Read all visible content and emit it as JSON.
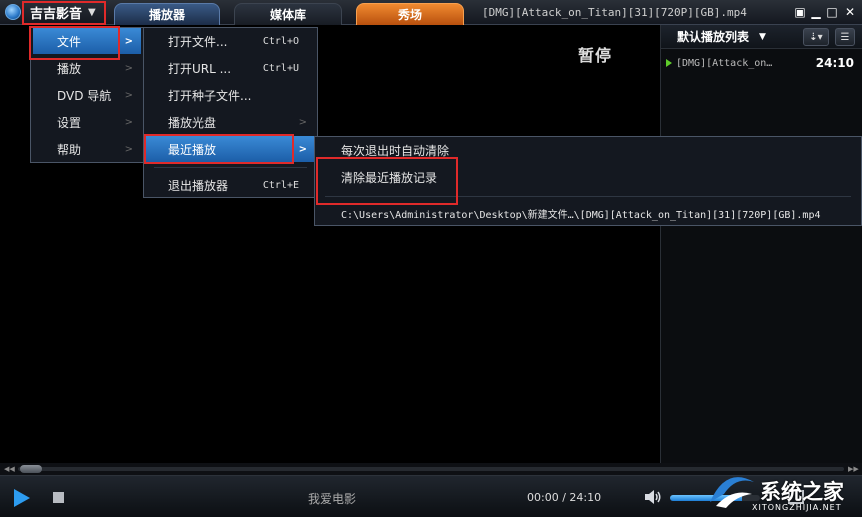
{
  "app": {
    "name": "吉吉影音",
    "window_title": "[DMG][Attack_on_Titan][31][720P][GB].mp4",
    "osd_text": "暂停"
  },
  "tabs": [
    {
      "label": "播放器"
    },
    {
      "label": "媒体库"
    },
    {
      "label": "秀场"
    }
  ],
  "main_menu": {
    "items": [
      {
        "label": "文件"
      },
      {
        "label": "播放"
      },
      {
        "label": "DVD 导航"
      },
      {
        "label": "设置"
      },
      {
        "label": "帮助"
      }
    ]
  },
  "file_menu": {
    "items": [
      {
        "label": "打开文件...",
        "shortcut": "Ctrl+O"
      },
      {
        "label": "打开URL ...",
        "shortcut": "Ctrl+U"
      },
      {
        "label": "打开种子文件..."
      },
      {
        "label": "播放光盘"
      },
      {
        "label": "最近播放"
      },
      {
        "label": "退出播放器",
        "shortcut": "Ctrl+E"
      }
    ]
  },
  "recent_menu": {
    "items": [
      {
        "label": "每次退出时自动清除"
      },
      {
        "label": "清除最近播放记录"
      },
      {
        "label": "C:\\Users\\Administrator\\Desktop\\新建文件…\\[DMG][Attack_on_Titan][31][720P][GB].mp4"
      }
    ]
  },
  "playlist": {
    "title": "默认播放列表",
    "items": [
      {
        "name": "[DMG][Attack_on…",
        "duration": "24:10"
      }
    ]
  },
  "controls": {
    "now_playing": "我爱电影",
    "time_current": "00:00",
    "time_separator": "/",
    "time_total": "24:10",
    "volume_percent": 80
  },
  "watermark": {
    "brand": "系统之家",
    "url": "XITONGZHIJIA.NET"
  },
  "colors": {
    "accent": "#2d9cf0",
    "highlight": "#e02a2a",
    "show_tab": "#f08a30"
  }
}
